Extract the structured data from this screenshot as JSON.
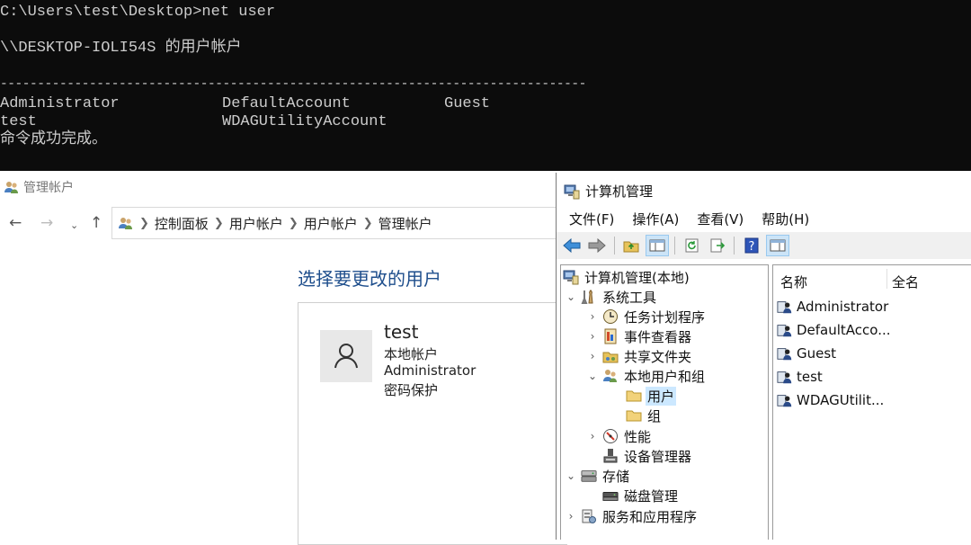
{
  "console": {
    "prompt_line": "C:\\Users\\test\\Desktop>net user",
    "header_line": "\\\\DESKTOP-IOLI54S 的用户帐户",
    "separator": "-------------------------------------------------------------------------------",
    "rows": [
      [
        "Administrator",
        "DefaultAccount",
        "Guest"
      ],
      [
        "test",
        "WDAGUtilityAccount",
        ""
      ]
    ],
    "done_line": "命令成功完成。"
  },
  "user_accounts": {
    "window_title": "管理帐户",
    "breadcrumb": [
      "控制面板",
      "用户帐户",
      "用户帐户",
      "管理帐户"
    ],
    "heading": "选择要更改的用户",
    "account": {
      "name": "test",
      "lines": [
        "本地帐户",
        "Administrator",
        "密码保护"
      ]
    }
  },
  "computer_management": {
    "window_title": "计算机管理",
    "menu": [
      "文件(F)",
      "操作(A)",
      "查看(V)",
      "帮助(H)"
    ],
    "tree": [
      {
        "label": "计算机管理(本地)",
        "icon": "computer-mgmt-icon",
        "expander": ""
      },
      {
        "label": "系统工具",
        "icon": "tools-icon",
        "expander": "down"
      },
      {
        "label": "任务计划程序",
        "icon": "clock-icon",
        "expander": "right"
      },
      {
        "label": "事件查看器",
        "icon": "event-viewer-icon",
        "expander": "right"
      },
      {
        "label": "共享文件夹",
        "icon": "shared-folder-icon",
        "expander": "right"
      },
      {
        "label": "本地用户和组",
        "icon": "users-groups-icon",
        "expander": "down"
      },
      {
        "label": "用户",
        "icon": "folder-icon",
        "expander": "",
        "selected": true
      },
      {
        "label": "组",
        "icon": "folder-icon",
        "expander": ""
      },
      {
        "label": "性能",
        "icon": "performance-icon",
        "expander": "right"
      },
      {
        "label": "设备管理器",
        "icon": "device-manager-icon",
        "expander": ""
      },
      {
        "label": "存储",
        "icon": "storage-icon",
        "expander": "down"
      },
      {
        "label": "磁盘管理",
        "icon": "disk-icon",
        "expander": ""
      },
      {
        "label": "服务和应用程序",
        "icon": "services-icon",
        "expander": "right"
      }
    ],
    "list_columns": [
      "名称",
      "全名"
    ],
    "users": [
      "Administrator",
      "DefaultAcco...",
      "Guest",
      "test",
      "WDAGUtilit..."
    ]
  }
}
